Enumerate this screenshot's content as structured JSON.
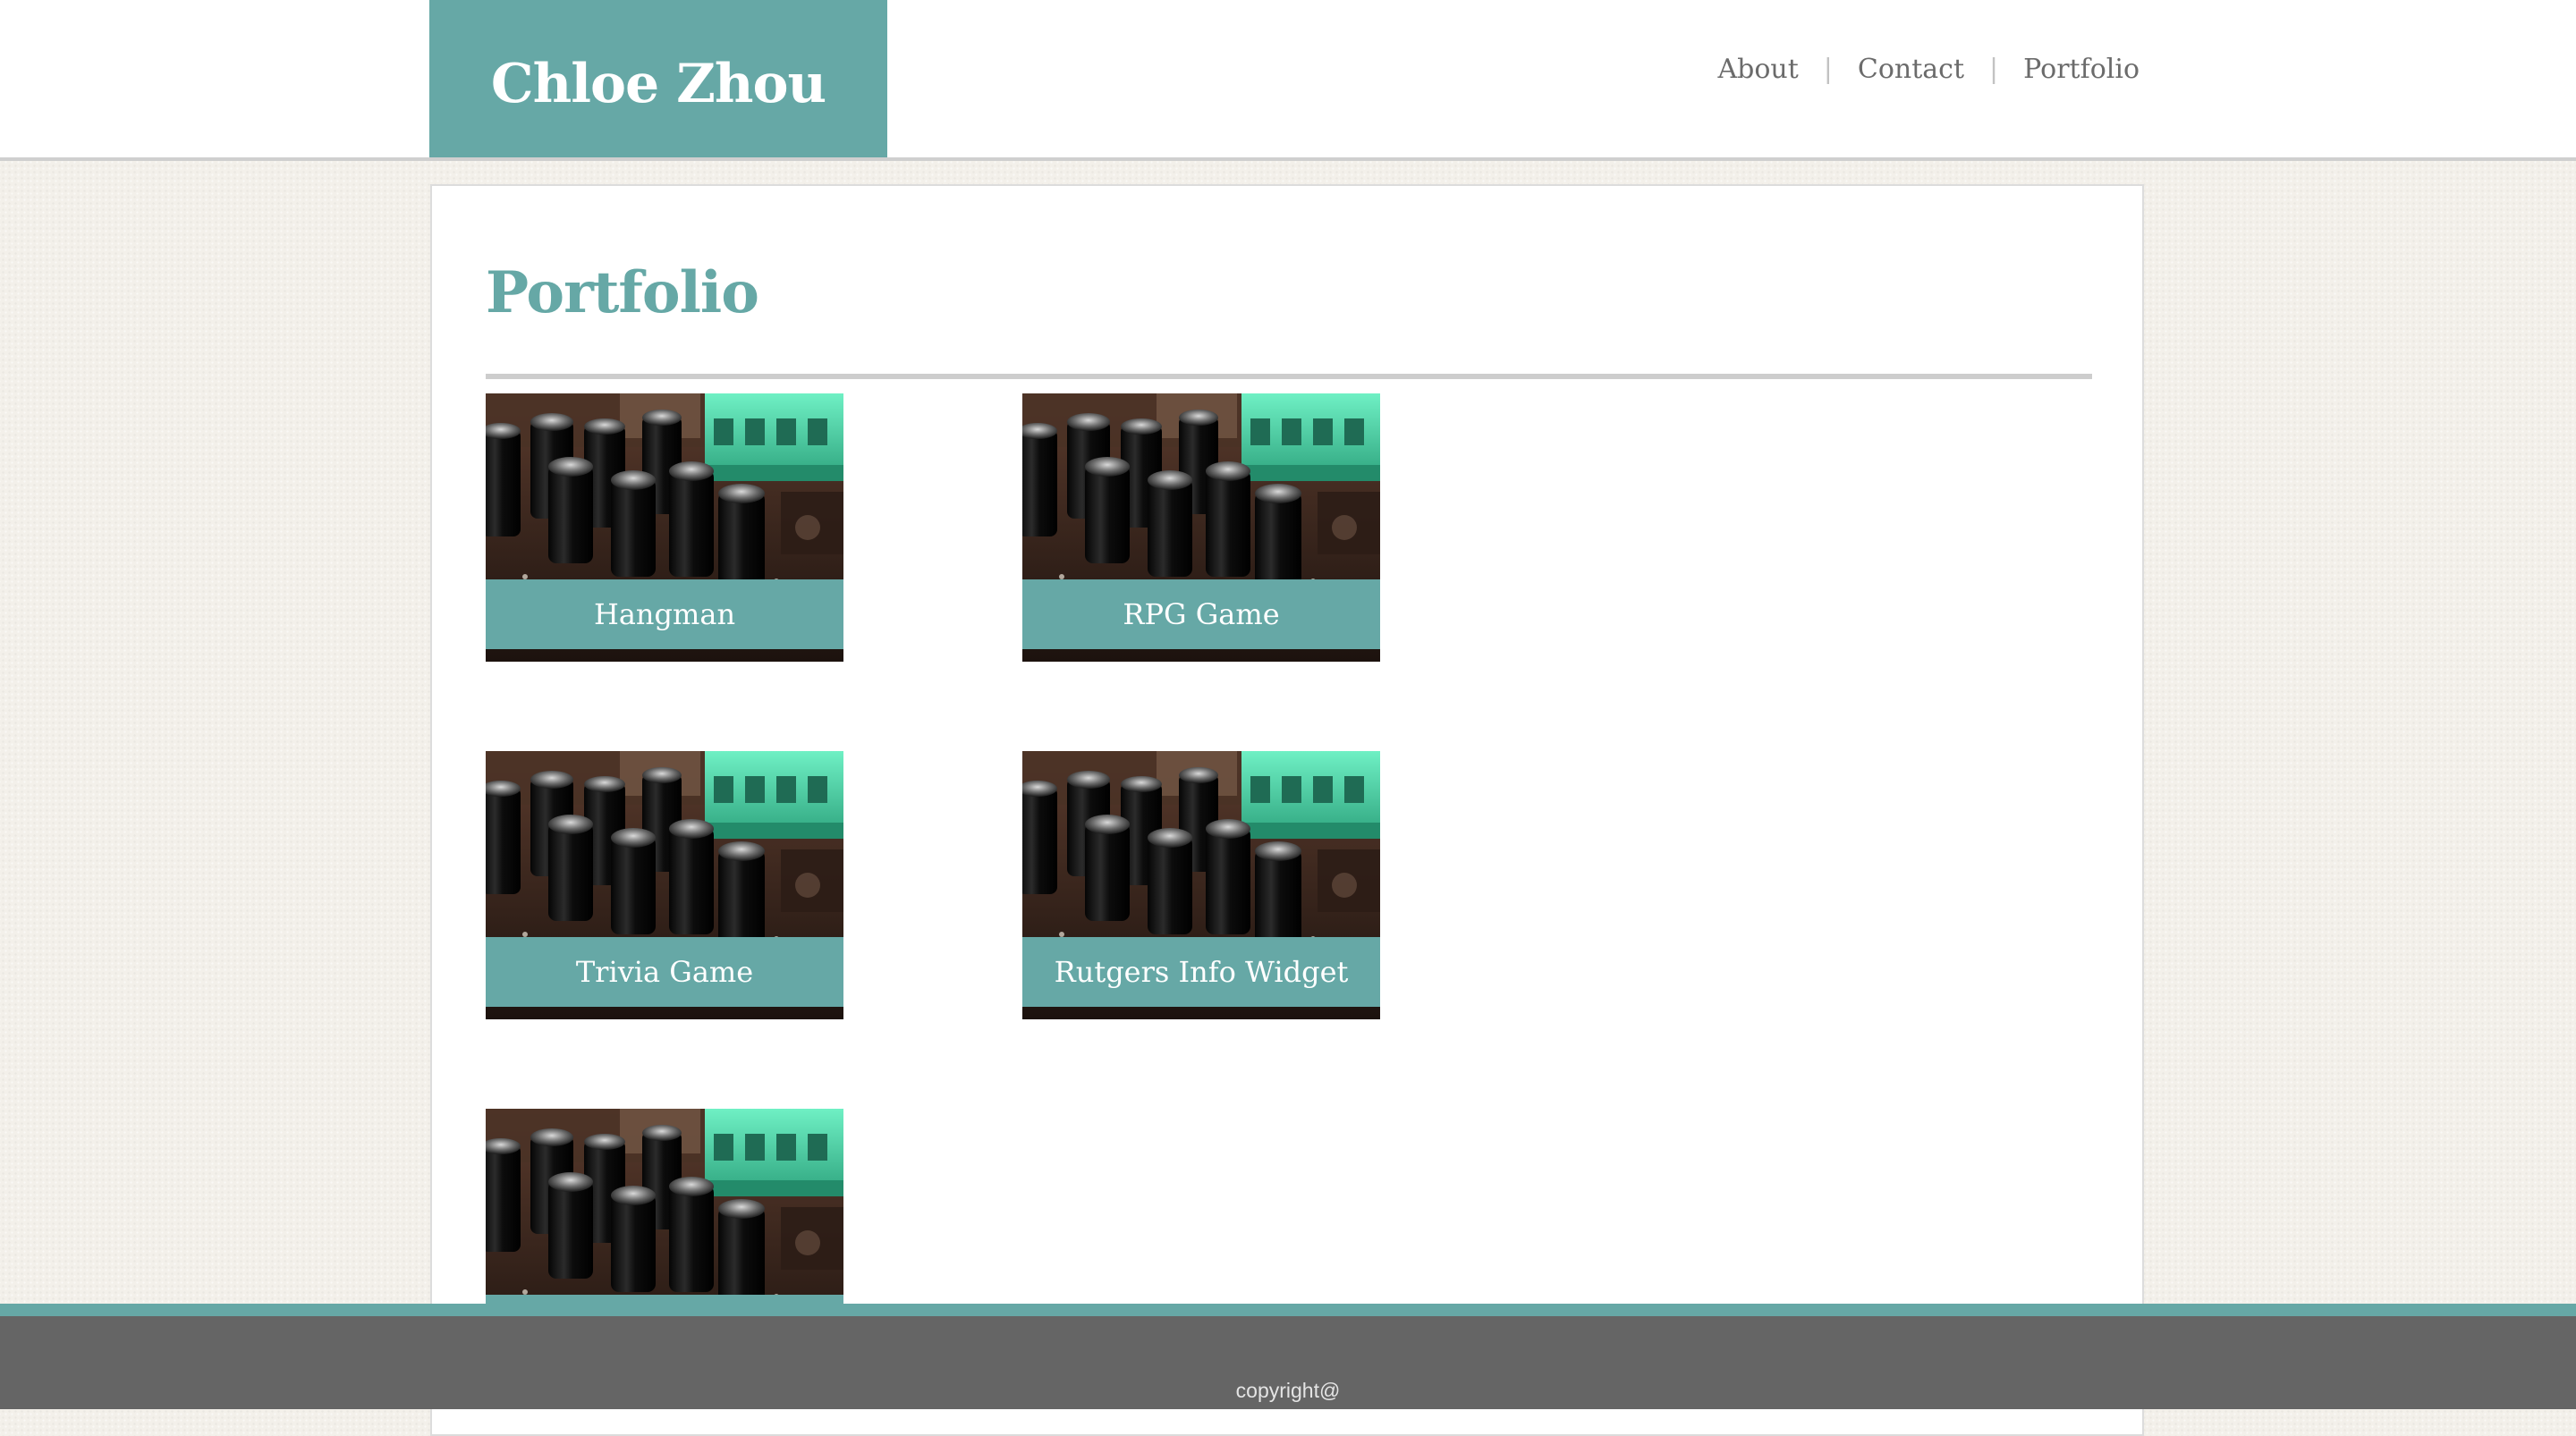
{
  "header": {
    "brand": "Chloe Zhou",
    "nav": [
      {
        "label": "About"
      },
      {
        "label": "Contact"
      },
      {
        "label": "Portfolio"
      }
    ],
    "nav_separator": "|"
  },
  "main": {
    "title": "Portfolio",
    "projects": [
      {
        "label": "Hangman"
      },
      {
        "label": "RPG Game"
      },
      {
        "label": "Trivia Game"
      },
      {
        "label": "Rutgers Info Widget"
      },
      {
        "label": ""
      }
    ],
    "thumbnail_icon": "circuit-board-photo"
  },
  "footer": {
    "text": "copyright@"
  },
  "colors": {
    "accent": "#66a8a6",
    "footer_bg": "#656565",
    "page_bg": "#f3f0ea",
    "nav_text": "#6b6b6b"
  }
}
